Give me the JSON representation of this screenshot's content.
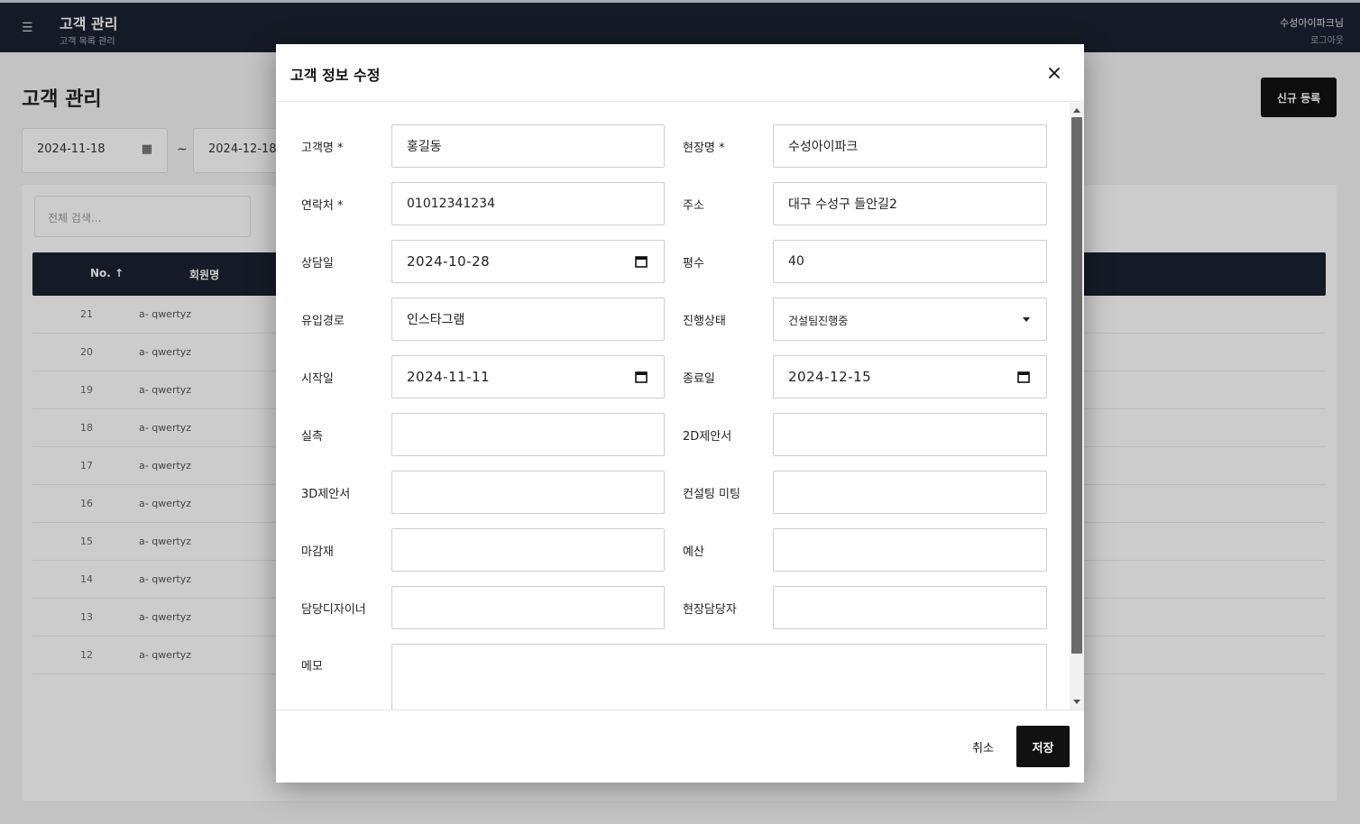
{
  "app": {
    "title": "고객 관리",
    "subtitle": "고객 목록 관리",
    "user_name": "수성아이파크님",
    "user_sub": "로그아웃"
  },
  "page": {
    "title": "고객 관리",
    "new_button": "신규 등록",
    "date_from": "2024-11-18",
    "date_to": "2024-12-18",
    "date_separator": "~",
    "search_placeholder": "전체 검색...",
    "table_headers": [
      "No. ↑",
      "회원명"
    ],
    "rows": [
      {
        "no": "21",
        "phone": "a- qwertyz"
      },
      {
        "no": "20",
        "phone": "a- qwertyz"
      },
      {
        "no": "19",
        "phone": "a- qwertyz"
      },
      {
        "no": "18",
        "phone": "a- qwertyz"
      },
      {
        "no": "17",
        "phone": "a- qwertyz"
      },
      {
        "no": "16",
        "phone": "a- qwertyz"
      },
      {
        "no": "15",
        "phone": "a- qwertyz"
      },
      {
        "no": "14",
        "phone": "a- qwertyz"
      },
      {
        "no": "13",
        "phone": "a- qwertyz"
      },
      {
        "no": "12",
        "phone": "a- qwertyz"
      }
    ]
  },
  "modal": {
    "title": "고객 정보 수정",
    "close_icon": "close-icon",
    "fields": {
      "customer_name": {
        "label": "고객명 *",
        "value": "홍길동"
      },
      "site_name": {
        "label": "현장명 *",
        "value": "수성아이파크"
      },
      "contact": {
        "label": "연락처 *",
        "value": "01012341234"
      },
      "address": {
        "label": "주소",
        "value": "대구 수성구 들안길2"
      },
      "consult_date": {
        "label": "상담일",
        "value": "2024-10-28"
      },
      "area": {
        "label": "평수",
        "value": "40"
      },
      "source": {
        "label": "유입경로",
        "value": "인스타그램"
      },
      "status": {
        "label": "진행상태",
        "value": "건설팀진행중"
      },
      "start_date": {
        "label": "시작일",
        "value": "2024-11-11"
      },
      "end_date": {
        "label": "종료일",
        "value": "2024-12-15"
      },
      "measure": {
        "label": "실측",
        "value": ""
      },
      "proposal_2d": {
        "label": "2D제안서",
        "value": ""
      },
      "proposal_3d": {
        "label": "3D제안서",
        "value": ""
      },
      "consult_meeting": {
        "label": "컨설팅 미팅",
        "value": ""
      },
      "finishing": {
        "label": "마감재",
        "value": ""
      },
      "budget": {
        "label": "예산",
        "value": ""
      },
      "designer": {
        "label": "담당디자이너",
        "value": ""
      },
      "site_manager": {
        "label": "현장담당자",
        "value": ""
      },
      "memo": {
        "label": "메모",
        "value": ""
      }
    },
    "cancel_label": "취소",
    "save_label": "저장"
  }
}
